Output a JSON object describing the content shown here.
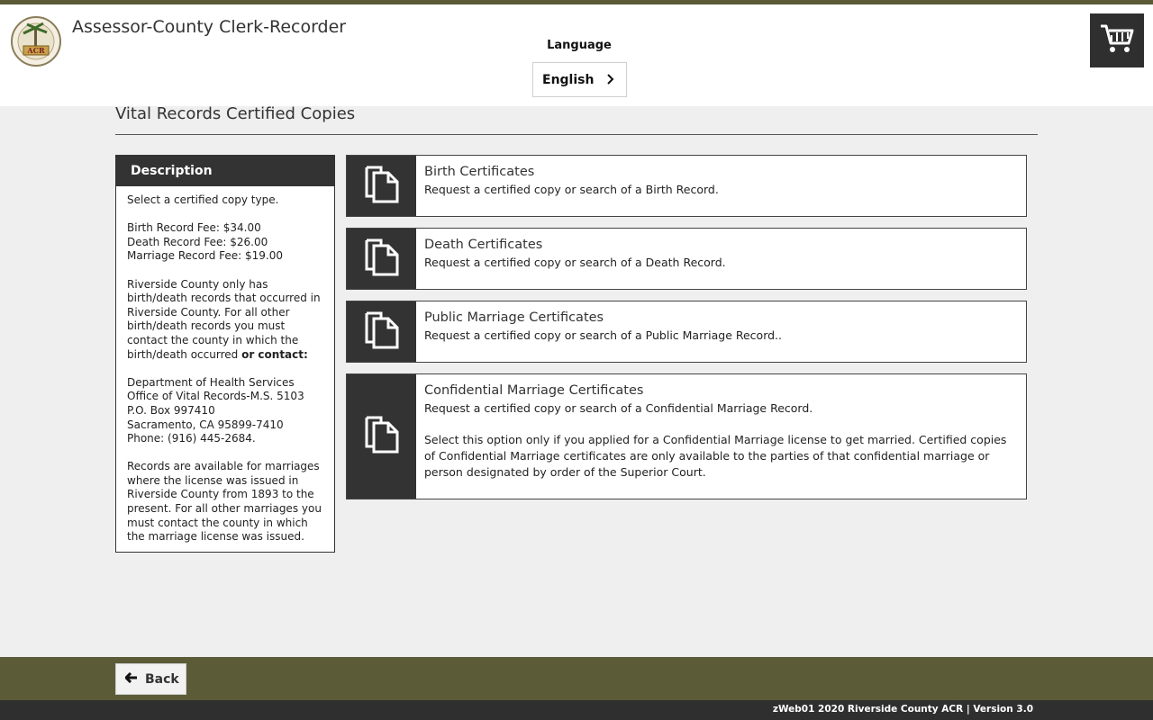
{
  "header": {
    "app_title": "Assessor-County Clerk-Recorder",
    "language_label": "Language",
    "language_value": "English",
    "logo_icon": "county-seal-logo",
    "cart_icon": "shopping-cart-icon"
  },
  "page": {
    "title": "Vital Records Certified Copies"
  },
  "description": {
    "heading": "Description",
    "intro": "Select a certified copy type.",
    "fees": [
      "Birth Record Fee: $34.00",
      "Death Record Fee: $26.00",
      "Marriage Record Fee: $19.00"
    ],
    "note_lines": [
      "Riverside County only has",
      "birth/death records that occurred in",
      "Riverside County. For all other",
      "birth/death records you must",
      "contact the county in which the"
    ],
    "note_last": "birth/death occurred ",
    "note_bold": "or contact:",
    "address": [
      "Department of Health Services",
      "Office of Vital Records-M.S. 5103",
      "P.O. Box 997410",
      "Sacramento, CA 95899-7410",
      "Phone: (916) 445-2684."
    ],
    "marriage_note": [
      "Records are available for marriages",
      "where the license was issued in",
      "Riverside County from 1893 to the",
      "present. For all other marriages you",
      "must contact the county in which",
      "the marriage license was issued."
    ]
  },
  "cards": [
    {
      "title": "Birth Certificates",
      "desc": "Request a certified copy or search of a Birth Record.",
      "icon": "copy-document-icon"
    },
    {
      "title": "Death Certificates",
      "desc": "Request a certified copy or search of a Death Record.",
      "icon": "copy-document-icon"
    },
    {
      "title": "Public Marriage Certificates",
      "desc": "Request a certified copy or search of a Public Marriage Record..",
      "icon": "copy-document-icon"
    },
    {
      "title": "Confidential Marriage Certificates",
      "desc": "Request a certified copy or search of a Confidential Marriage Record.",
      "note": "Select this option only if you applied for a Confidential Marriage license to get married. Certified copies of Confidential Marriage certificates are only available to the parties of that confidential marriage or person designated by order of the Superior Court.",
      "icon": "copy-document-icon"
    }
  ],
  "footer": {
    "back_label": "Back",
    "version_text": "zWeb01 2020 Riverside County ACR | Version 3.0"
  },
  "colors": {
    "olive_bar": "#5b5b38",
    "dark": "#333333",
    "background": "#efefef"
  }
}
